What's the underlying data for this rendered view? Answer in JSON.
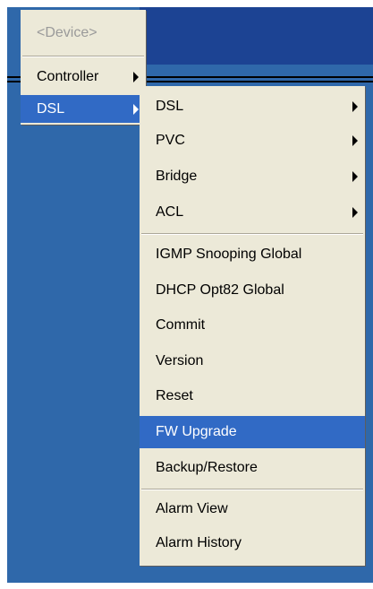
{
  "menus": {
    "main": {
      "items": [
        {
          "label": "<Device>"
        },
        {
          "label": "Controller"
        },
        {
          "label": "DSL"
        }
      ]
    },
    "dsl_submenu": {
      "items": [
        {
          "label": "DSL"
        },
        {
          "label": "PVC"
        },
        {
          "label": "Bridge"
        },
        {
          "label": "ACL"
        },
        {
          "label": "IGMP Snooping Global"
        },
        {
          "label": "DHCP Opt82 Global"
        },
        {
          "label": "Commit"
        },
        {
          "label": "Version"
        },
        {
          "label": "Reset"
        },
        {
          "label": "FW Upgrade"
        },
        {
          "label": "Backup/Restore"
        },
        {
          "label": "Alarm View"
        },
        {
          "label": "Alarm History"
        }
      ]
    }
  },
  "colors": {
    "desktop": "#2f68aa",
    "header": "#1c4393",
    "menu_background": "#ece9d8",
    "selection": "#316ac5"
  }
}
